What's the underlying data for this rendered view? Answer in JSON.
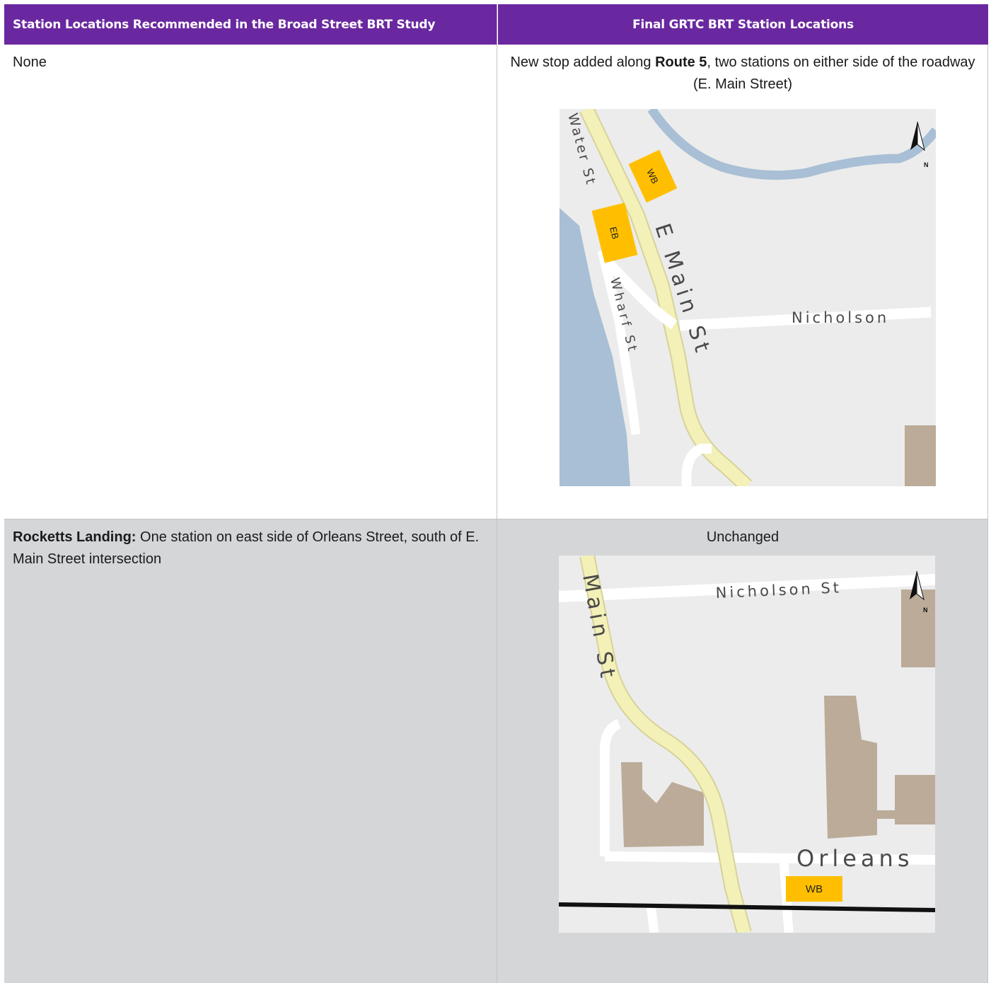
{
  "header": {
    "left": "Station Locations Recommended in the Broad Street BRT Study",
    "right": "Final GRTC BRT Station Locations"
  },
  "rows": [
    {
      "left_text": "None",
      "right_pre": "New stop added along ",
      "right_bold": "Route 5",
      "right_post": ", two stations on either side of the roadway (E. Main Street)",
      "map": {
        "street_labels": [
          "Water St",
          "E Main St",
          "Wharf St",
          "Nicholson"
        ],
        "station_labels": [
          "WB",
          "EB"
        ],
        "north_label": "N"
      }
    },
    {
      "left_bold": "Rocketts Landing:",
      "left_text": " One station on east side of Orleans Street, south of E. Main Street intersection",
      "right_text": "Unchanged",
      "map": {
        "street_labels": [
          "Nicholson St",
          "Main St",
          "Orleans"
        ],
        "station_labels": [
          "WB"
        ],
        "north_label": "N"
      }
    }
  ],
  "colors": {
    "header_bg": "#6a28a0",
    "station_marker": "#ffbf00",
    "road": "#f3f1b8",
    "water": "#a8bfd5",
    "building": "#bbab98",
    "row2_bg": "#d5d6d8"
  }
}
